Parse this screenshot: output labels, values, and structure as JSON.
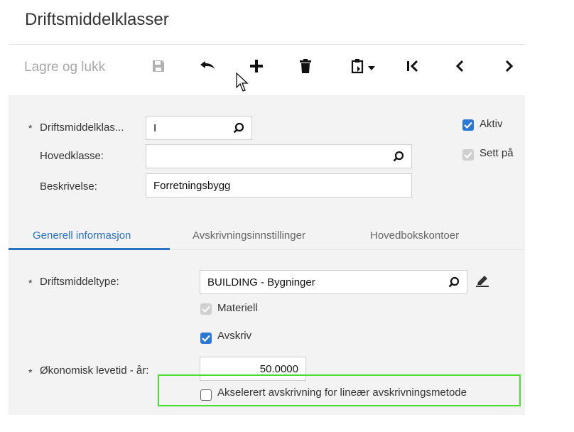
{
  "page": {
    "title": "Driftsmiddelklasser"
  },
  "toolbar": {
    "save_close_label": "Lagre og lukk",
    "icons": [
      "save-icon",
      "undo-icon",
      "plus-icon",
      "trash-icon",
      "clipboard-icon",
      "chevron-down-icon",
      "first-page-icon",
      "previous-icon",
      "next-icon"
    ]
  },
  "header": {
    "class_label": "Driftsmiddelklas...",
    "class_value": "I",
    "main_class_label": "Hovedklasse:",
    "main_class_value": "",
    "description_label": "Beskrivelse:",
    "description_value": "Forretningsbygg",
    "active_label": "Aktiv",
    "active_checked": true,
    "sett_label": "Sett på",
    "sett_checked": true
  },
  "tabs": [
    {
      "label": "Generell informasjon",
      "active": true
    },
    {
      "label": "Avskrivningsinnstillinger",
      "active": false
    },
    {
      "label": "Hovedbokskontoer",
      "active": false
    }
  ],
  "general": {
    "asset_type_label": "Driftsmiddeltype:",
    "asset_type_value": "BUILDING - Bygninger",
    "material_label": "Materiell",
    "material_checked": true,
    "depreciate_label": "Avskriv",
    "depreciate_checked": true,
    "useful_life_label": "Økonomisk levetid - år:",
    "useful_life_value": "50.0000",
    "accelerated_label": "Akselerert avskrivning for lineær avskrivningsmetode",
    "accelerated_checked": false
  },
  "colors": {
    "accent": "#2a72c2",
    "highlight": "#4ddc33",
    "panel": "#f3f3f3"
  }
}
